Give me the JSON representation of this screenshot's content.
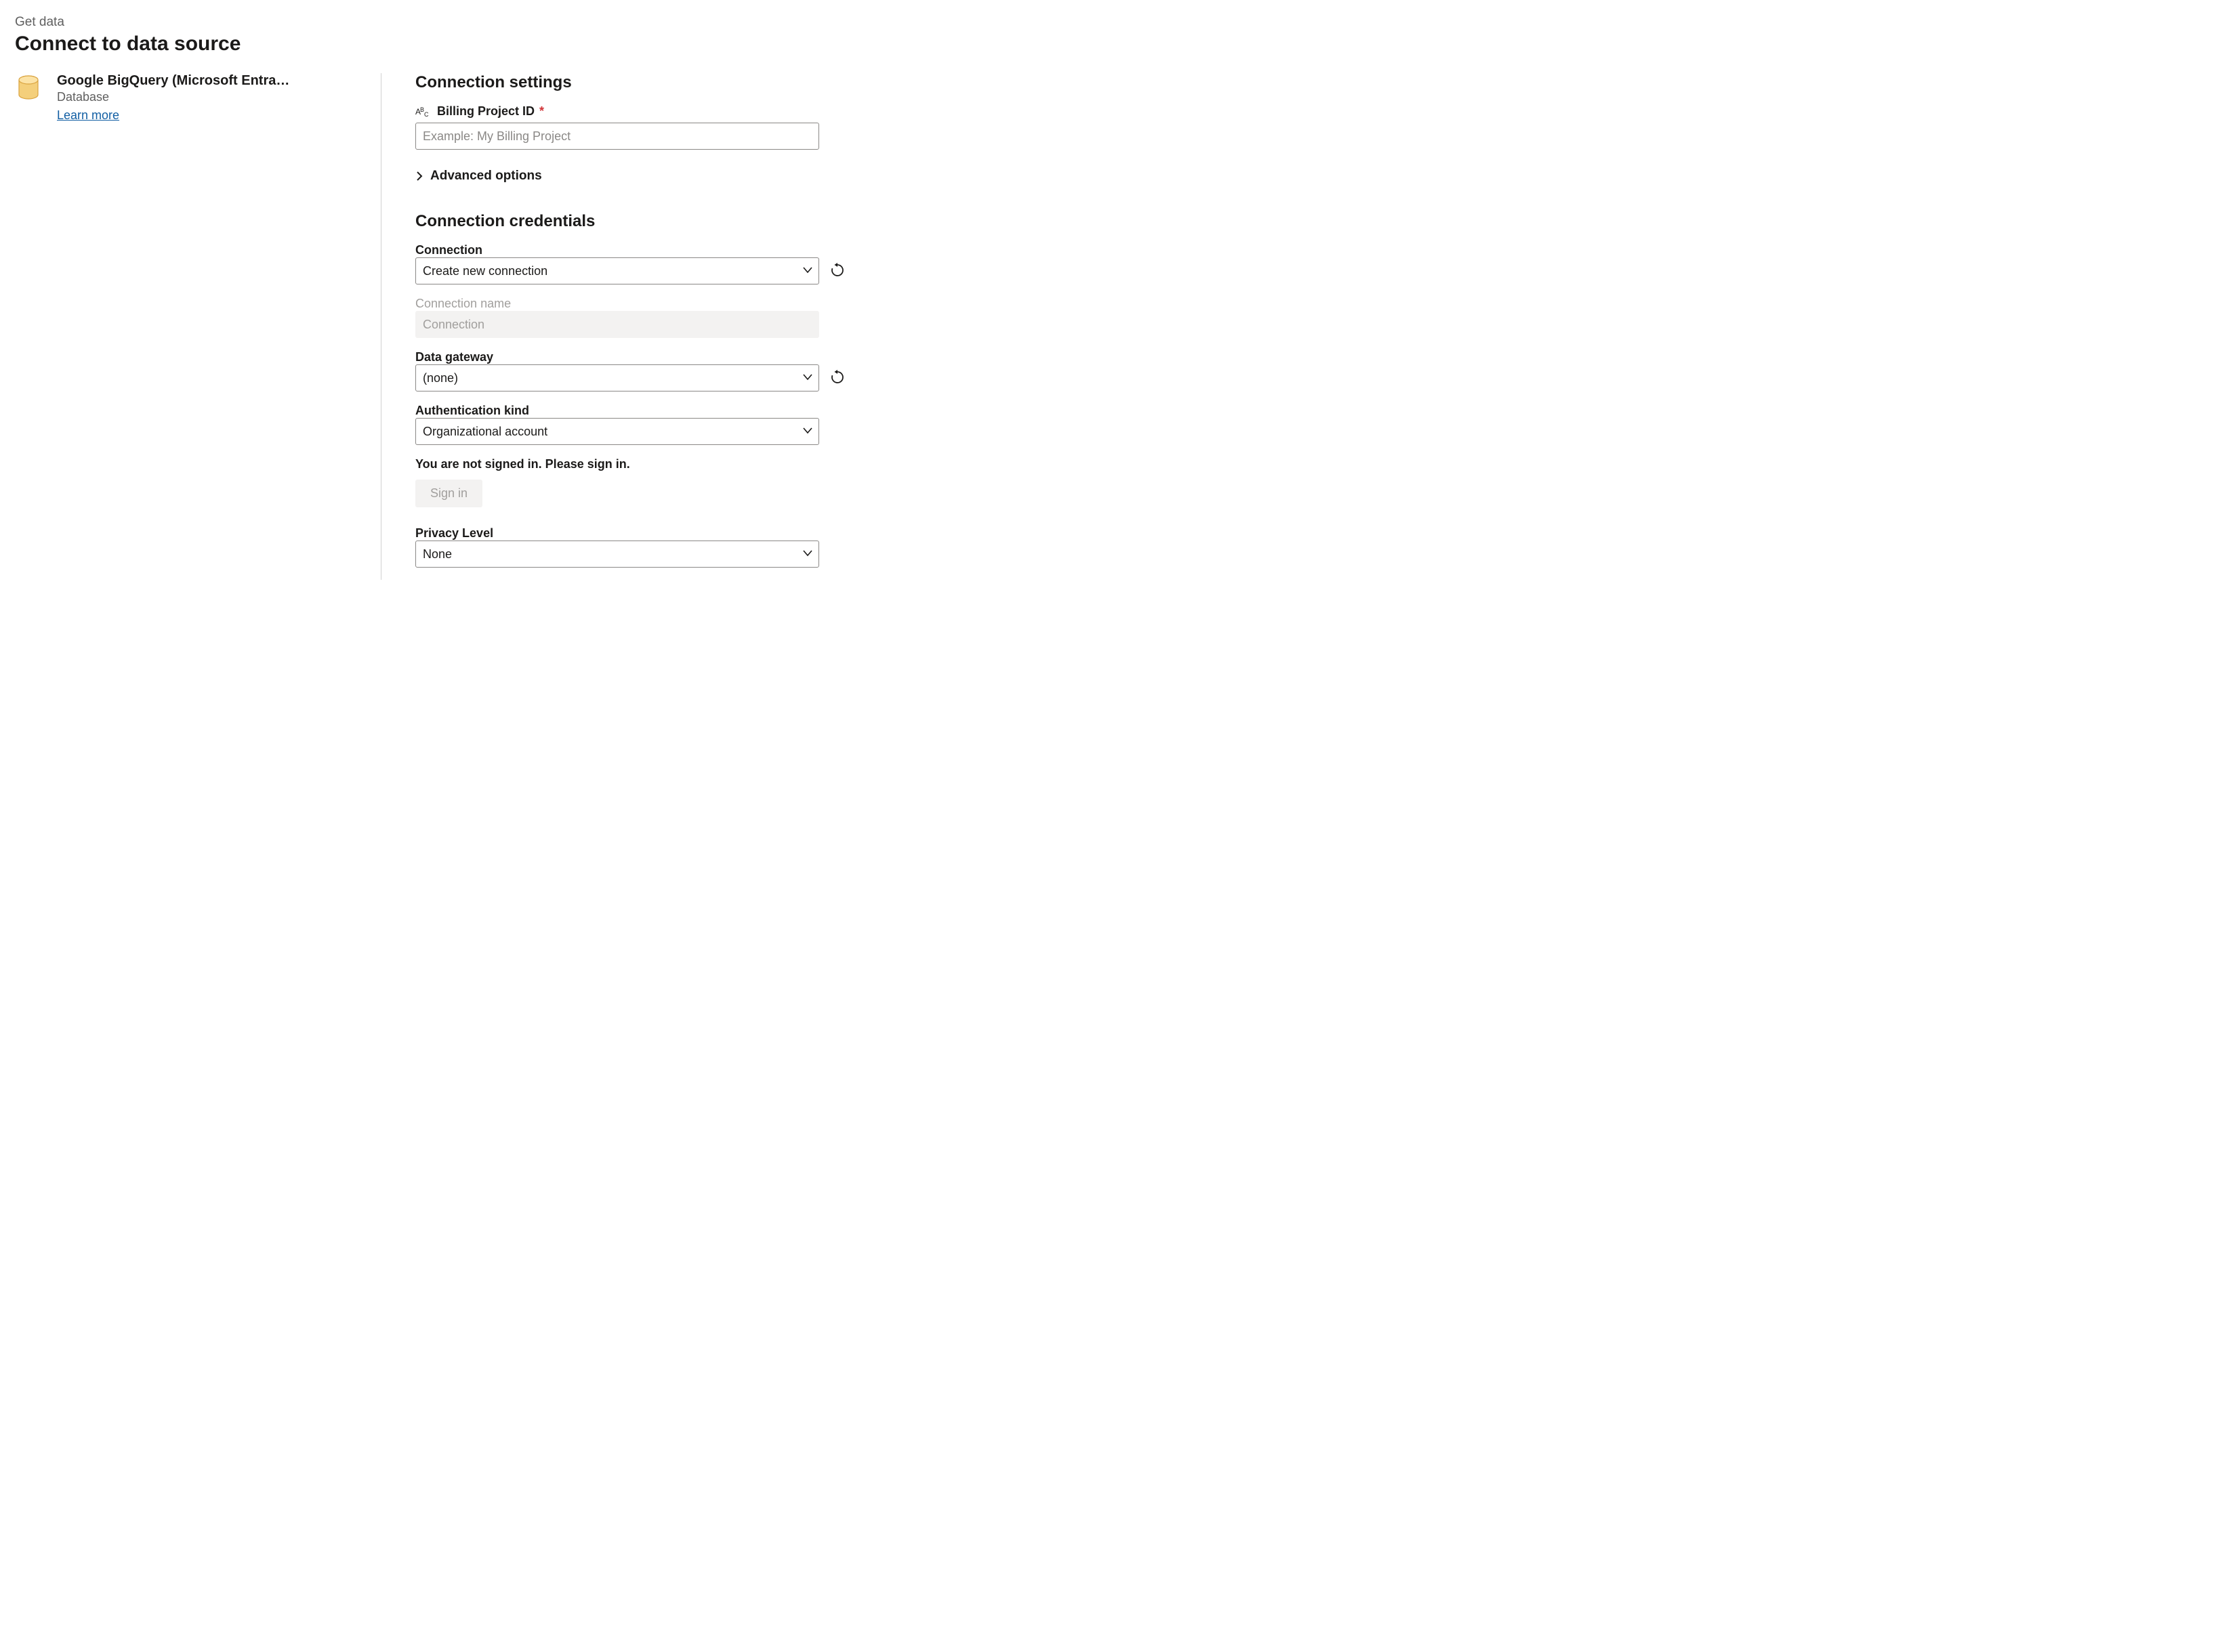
{
  "header": {
    "breadcrumb": "Get data",
    "title": "Connect to data source"
  },
  "connector": {
    "title": "Google BigQuery (Microsoft Entra…",
    "subtitle": "Database",
    "learn_more": "Learn more"
  },
  "settings": {
    "heading": "Connection settings",
    "billing_project": {
      "label": "Billing Project ID",
      "placeholder": "Example: My Billing Project",
      "required_marker": "*"
    },
    "advanced_label": "Advanced options"
  },
  "credentials": {
    "heading": "Connection credentials",
    "connection": {
      "label": "Connection",
      "value": "Create new connection"
    },
    "connection_name": {
      "label": "Connection name",
      "value": "Connection"
    },
    "data_gateway": {
      "label": "Data gateway",
      "value": "(none)"
    },
    "auth_kind": {
      "label": "Authentication kind",
      "value": "Organizational account"
    },
    "signin": {
      "message": "You are not signed in. Please sign in.",
      "button": "Sign in"
    },
    "privacy": {
      "label": "Privacy Level",
      "value": "None"
    }
  }
}
